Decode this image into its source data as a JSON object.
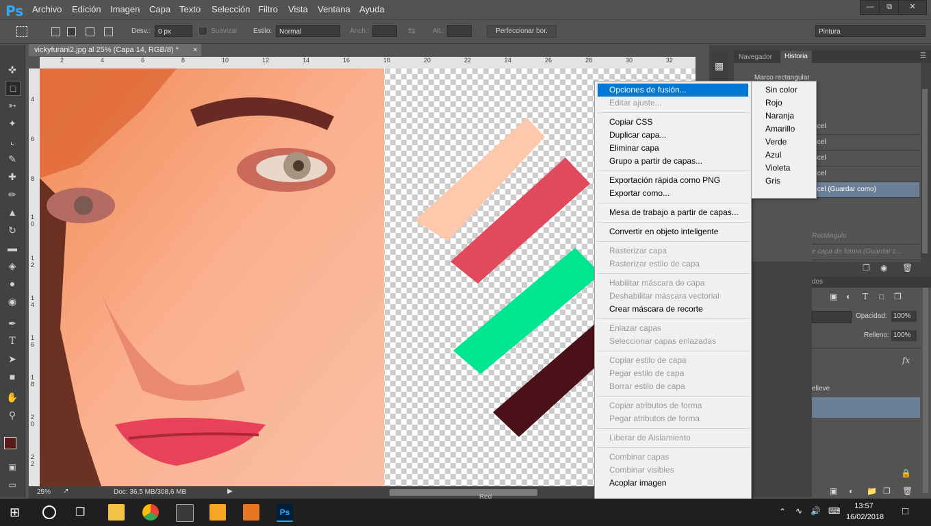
{
  "app": {
    "logo": "Ps"
  },
  "menubar": {
    "items": [
      "Archivo",
      "Edición",
      "Imagen",
      "Capa",
      "Texto",
      "Selección",
      "Filtro",
      "Vista",
      "Ventana",
      "Ayuda"
    ]
  },
  "options": {
    "desv_label": "Desv.:",
    "desv_value": "0 px",
    "suavizar_label": "Suavizar",
    "estilo_label": "Estilo:",
    "estilo_value": "Normal",
    "anch_label": "Anch.:",
    "alt_label": "Alt.:",
    "perfeccionar": "Perfeccionar bor.",
    "workspace": "Pintura"
  },
  "document": {
    "tab_title": "vickyfurani2.jpg al 25% (Capa 14, RGB/8) *",
    "ruler_top": [
      "2",
      "4",
      "6",
      "8",
      "10",
      "12",
      "14",
      "16",
      "18",
      "20",
      "22",
      "24",
      "26",
      "28",
      "30",
      "32"
    ],
    "ruler_left": [
      "4",
      "6",
      "8",
      "1 0",
      "1 2",
      "1 4",
      "1 6",
      "1 8",
      "2 0",
      "2 2"
    ]
  },
  "status": {
    "zoom": "25%",
    "doc": "Doc: 36,5 MB/308,6 MB"
  },
  "panels": {
    "tabs": [
      "Navegador",
      "Historia"
    ],
    "history": [
      "Marco rectangular",
      "incel",
      "incel",
      "incel",
      "incel",
      "incel (Guardar como)",
      "Rectángulo",
      "e capa de forma (Guardar c..."
    ],
    "layers_tab_fragment": "dos",
    "opacity_label": "Opacidad:",
    "opacity_value": "100%",
    "fill_label": "Relleno:",
    "fill_value": "100%",
    "fx_label": "fx",
    "relieve_label": "elieve",
    "red_label": "Red"
  },
  "context_menu": {
    "items": [
      {
        "label": "Opciones de fusión...",
        "state": "selected"
      },
      {
        "label": "Editar ajuste...",
        "state": "disabled"
      },
      {
        "label": "Copiar CSS",
        "state": "enabled"
      },
      {
        "label": "Duplicar capa...",
        "state": "enabled"
      },
      {
        "label": "Eliminar capa",
        "state": "enabled"
      },
      {
        "label": "Grupo a partir de capas...",
        "state": "enabled"
      },
      {
        "label": "Exportación rápida como PNG",
        "state": "enabled"
      },
      {
        "label": "Exportar como...",
        "state": "enabled"
      },
      {
        "label": "Mesa de trabajo a partir de capas...",
        "state": "enabled"
      },
      {
        "label": "Convertir en objeto inteligente",
        "state": "enabled"
      },
      {
        "label": "Rasterizar capa",
        "state": "disabled"
      },
      {
        "label": "Rasterizar estilo de capa",
        "state": "disabled"
      },
      {
        "label": "Habilitar máscara de capa",
        "state": "disabled"
      },
      {
        "label": "Deshabilitar máscara vectorial",
        "state": "disabled"
      },
      {
        "label": "Crear máscara de recorte",
        "state": "enabled"
      },
      {
        "label": "Enlazar capas",
        "state": "disabled"
      },
      {
        "label": "Seleccionar capas enlazadas",
        "state": "disabled"
      },
      {
        "label": "Copiar estilo de capa",
        "state": "disabled"
      },
      {
        "label": "Pegar estilo de capa",
        "state": "disabled"
      },
      {
        "label": "Borrar estilo de capa",
        "state": "disabled"
      },
      {
        "label": "Copiar atributos de forma",
        "state": "disabled"
      },
      {
        "label": "Pegar atributos de forma",
        "state": "disabled"
      },
      {
        "label": "Liberar de Aislamiento",
        "state": "disabled"
      },
      {
        "label": "Combinar capas",
        "state": "disabled"
      },
      {
        "label": "Combinar visibles",
        "state": "disabled"
      },
      {
        "label": "Acoplar imagen",
        "state": "enabled"
      }
    ]
  },
  "color_submenu": {
    "items": [
      "Sin color",
      "Rojo",
      "Naranja",
      "Amarillo",
      "Verde",
      "Azul",
      "Violeta",
      "Gris"
    ]
  },
  "taskbar": {
    "time": "13:57",
    "date": "16/02/2018"
  },
  "colors": {
    "accent": "#0078d7",
    "ps_blue": "#31a8ff",
    "foreground_swatch": "#5a1a1a",
    "stroke_peach": "#fec8ad",
    "stroke_red": "#e04a5c",
    "stroke_green": "#00e58f",
    "stroke_maroon": "#4a1218"
  }
}
